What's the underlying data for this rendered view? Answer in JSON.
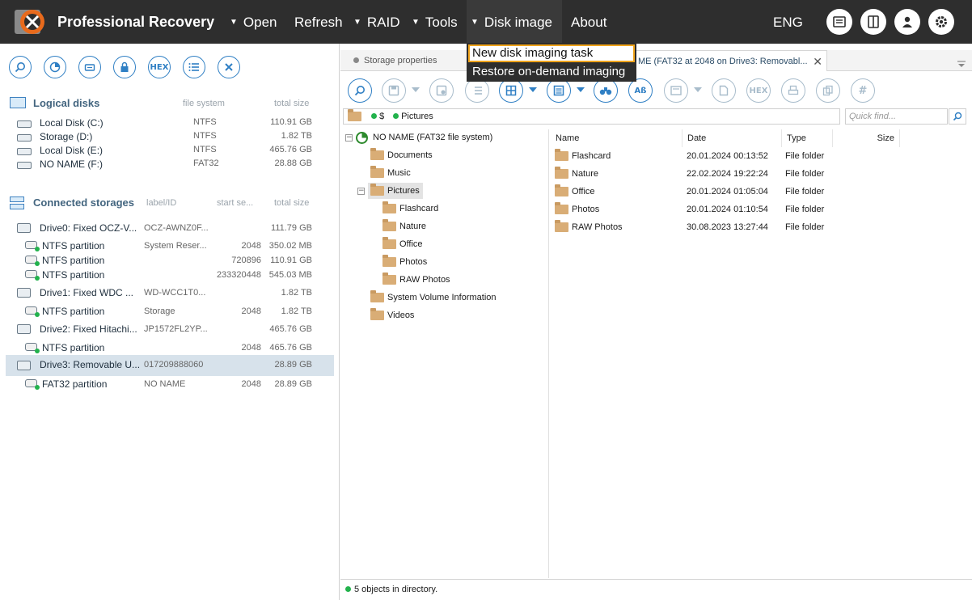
{
  "app": {
    "title": "Professional Recovery"
  },
  "menu": [
    {
      "label": "Open",
      "arrow": true
    },
    {
      "label": "Refresh",
      "arrow": false
    },
    {
      "label": "RAID",
      "arrow": true
    },
    {
      "label": "Tools",
      "arrow": true
    },
    {
      "label": "Disk image",
      "arrow": true,
      "active": true
    },
    {
      "label": "About",
      "arrow": false
    }
  ],
  "lang": "ENG",
  "dropdown": {
    "items": [
      "New disk imaging task",
      "Restore on-demand imaging"
    ]
  },
  "left": {
    "logical_title": "Logical disks",
    "logical_cols": {
      "fs": "file system",
      "size": "total size"
    },
    "logical": [
      {
        "name": "Local Disk (C:)",
        "fs": "NTFS",
        "size": "110.91 GB"
      },
      {
        "name": "Storage (D:)",
        "fs": "NTFS",
        "size": "1.82 TB"
      },
      {
        "name": "Local Disk (E:)",
        "fs": "NTFS",
        "size": "465.76 GB"
      },
      {
        "name": "NO NAME (F:)",
        "fs": "FAT32",
        "size": "28.88 GB"
      }
    ],
    "storages_title": "Connected storages",
    "storages_cols": {
      "label": "label/ID",
      "start": "start se...",
      "size": "total size"
    },
    "storages": [
      {
        "name": "Drive0: Fixed OCZ-V...",
        "label": "OCZ-AWNZ0F...",
        "start": "",
        "size": "111.79 GB",
        "kind": "drive"
      },
      {
        "name": "NTFS partition",
        "label": "System Reser...",
        "start": "2048",
        "size": "350.02 MB",
        "kind": "part"
      },
      {
        "name": "NTFS partition",
        "label": "",
        "start": "720896",
        "size": "110.91 GB",
        "kind": "part"
      },
      {
        "name": "NTFS partition",
        "label": "",
        "start": "233320448",
        "size": "545.03 MB",
        "kind": "part"
      },
      {
        "name": "Drive1: Fixed WDC ...",
        "label": "WD-WCC1T0...",
        "start": "",
        "size": "1.82 TB",
        "kind": "drive"
      },
      {
        "name": "NTFS partition",
        "label": "Storage",
        "start": "2048",
        "size": "1.82 TB",
        "kind": "part"
      },
      {
        "name": "Drive2: Fixed Hitachi...",
        "label": "JP1572FL2YP...",
        "start": "",
        "size": "465.76 GB",
        "kind": "drive"
      },
      {
        "name": "NTFS partition",
        "label": "",
        "start": "2048",
        "size": "465.76 GB",
        "kind": "part"
      },
      {
        "name": "Drive3: Removable U...",
        "label": "017209888060",
        "start": "",
        "size": "28.89 GB",
        "kind": "drive",
        "selected": true
      },
      {
        "name": "FAT32 partition",
        "label": "NO NAME",
        "start": "2048",
        "size": "28.89 GB",
        "kind": "part"
      }
    ]
  },
  "tabs": [
    {
      "label": "Storage properties"
    },
    {
      "label": "ME (FAT32 at 2048 on Drive3: Removabl..."
    }
  ],
  "toolbar_text": {
    "hex": "HEX",
    "ab": "Aß",
    "hash": "#"
  },
  "path": {
    "segments": [
      "$",
      "Pictures"
    ]
  },
  "quickfind": {
    "placeholder": "Quick find..."
  },
  "tree": {
    "root": "NO NAME (FAT32 file system)",
    "items": [
      "Documents",
      "Music",
      "Pictures",
      "Flashcard",
      "Nature",
      "Office",
      "Photos",
      "RAW Photos",
      "System Volume Information",
      "Videos"
    ]
  },
  "list": {
    "columns": [
      "Name",
      "Date",
      "Type",
      "Size"
    ],
    "rows": [
      {
        "name": "Flashcard",
        "date": "20.01.2024 00:13:52",
        "type": "File folder",
        "size": ""
      },
      {
        "name": "Nature",
        "date": "22.02.2024 19:22:24",
        "type": "File folder",
        "size": ""
      },
      {
        "name": "Office",
        "date": "20.01.2024 01:05:04",
        "type": "File folder",
        "size": ""
      },
      {
        "name": "Photos",
        "date": "20.01.2024 01:10:54",
        "type": "File folder",
        "size": ""
      },
      {
        "name": "RAW Photos",
        "date": "30.08.2023 13:27:44",
        "type": "File folder",
        "size": ""
      }
    ]
  },
  "status": "5 objects in directory.",
  "colors": {
    "topbar": "#2e2e2e",
    "accent": "#2f7fc4",
    "highlight": "#f0a41c",
    "green": "#22b24c"
  }
}
